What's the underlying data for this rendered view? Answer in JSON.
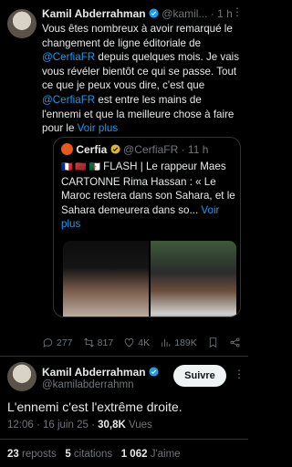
{
  "main_tweet": {
    "author_name": "Kamil Abderrahman",
    "author_handle": "@kamil...",
    "time": "· 1 h",
    "text_part1": "Vous êtes nombreux à avoir remarqué le changement de ligne éditoriale de ",
    "mention1": "@CerfiaFR",
    "text_part2": " depuis quelques mois. Je vais vous révéler bientôt ce qui se passe. Tout ce que je peux vous dire, c'est que ",
    "mention2": "@CerfiaFR",
    "text_part3": " est entre les mains de l'ennemi et que la meilleure chose à faire pour le ",
    "see_more": "Voir plus"
  },
  "quoted_tweet": {
    "author_name": "Cerfia",
    "author_handle": "@CerfiaFR",
    "time": "· 11 h",
    "flags": "🇫🇷 🇲🇦 🇩🇿",
    "text": "FLASH | Le rappeur Maes CARTONNE Rima Hassan : « Le Maroc restera dans son Sahara, et le Sahara demeurera dans so...",
    "see_more": "Voir plus"
  },
  "actions": {
    "replies": "277",
    "retweets": "817",
    "likes": "4K",
    "views": "189K"
  },
  "reply": {
    "author_name": "Kamil Abderrahman",
    "author_handle": "@kamilabderrahmn",
    "follow_label": "Suivre",
    "text": "L'ennemi c'est l'extrême droite.",
    "timestamp": "12:06 · 16 juin 25 · ",
    "views_count": "30,8K",
    "views_label": "Vues"
  },
  "stats": {
    "reposts_count": "23",
    "reposts_label": "reposts",
    "quotes_count": "5",
    "quotes_label": "citations",
    "likes_count": "1 062",
    "likes_label": "J'aime"
  },
  "colors": {
    "background": "#000000",
    "accent": "#1d9bf0",
    "muted": "#71767b",
    "text": "#e7e9ea"
  }
}
